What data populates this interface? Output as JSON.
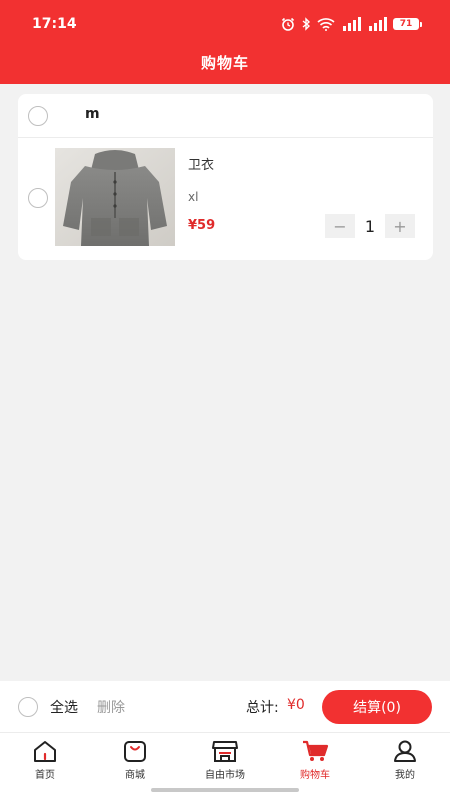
{
  "status_bar": {
    "time": "17:14",
    "battery": "71"
  },
  "header": {
    "title": "购物车"
  },
  "cart": {
    "store_name": "m",
    "items": [
      {
        "name": "卫衣",
        "spec": "xl",
        "price": "¥59",
        "quantity": "1"
      }
    ]
  },
  "stepper": {
    "minus": "−",
    "plus": "+"
  },
  "footer": {
    "select_all": "全选",
    "delete": "删除",
    "total_label": "总计:",
    "total_value": "¥0",
    "checkout": "结算(0)"
  },
  "tabbar": {
    "items": [
      {
        "label": "首页",
        "icon": "home-icon"
      },
      {
        "label": "商城",
        "icon": "shopping-bag-icon"
      },
      {
        "label": "自由市场",
        "icon": "storefront-icon"
      },
      {
        "label": "购物车",
        "icon": "cart-icon",
        "active": true
      },
      {
        "label": "我的",
        "icon": "person-icon"
      }
    ]
  },
  "colors": {
    "brand": "#f23131",
    "price": "#e02b2b",
    "background": "#f2f2f2"
  }
}
